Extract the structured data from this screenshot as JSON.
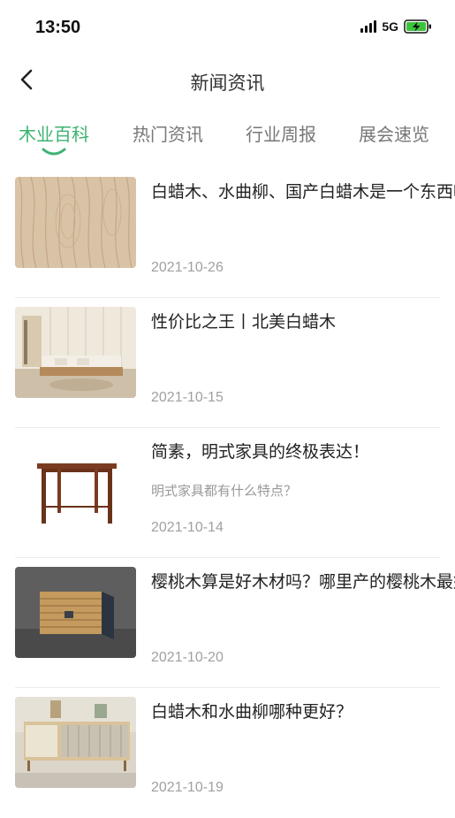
{
  "status_bar": {
    "time": "13:50",
    "network": "5G",
    "signal_icon": "signal-bars-icon",
    "battery_icon": "battery-charging-icon"
  },
  "nav": {
    "back_icon": "chevron-left-icon",
    "title": "新闻资讯"
  },
  "tabs": [
    {
      "label": "木业百科",
      "active": true
    },
    {
      "label": "热门资讯",
      "active": false
    },
    {
      "label": "行业周报",
      "active": false
    },
    {
      "label": "展会速览",
      "active": false
    }
  ],
  "accent_color": "#3cb371",
  "articles": [
    {
      "title": "白蜡木、水曲柳、国产白蜡木是一个东西吗？",
      "subtitle": "",
      "date": "2021-10-26",
      "image": "wood-grain-thumbnail"
    },
    {
      "title": "性价比之王丨北美白蜡木",
      "subtitle": "",
      "date": "2021-10-15",
      "image": "living-room-sofa-thumbnail"
    },
    {
      "title": "简素，明式家具的终极表达！",
      "subtitle": "明式家具都有什么特点？",
      "date": "2021-10-14",
      "image": "ming-style-table-thumbnail"
    },
    {
      "title": "樱桃木算是好木材吗？哪里产的樱桃木最好？",
      "subtitle": "",
      "date": "2021-10-20",
      "image": "stacked-lumber-thumbnail"
    },
    {
      "title": "白蜡木和水曲柳哪种更好？",
      "subtitle": "",
      "date": "2021-10-19",
      "image": "tv-cabinet-thumbnail"
    }
  ]
}
